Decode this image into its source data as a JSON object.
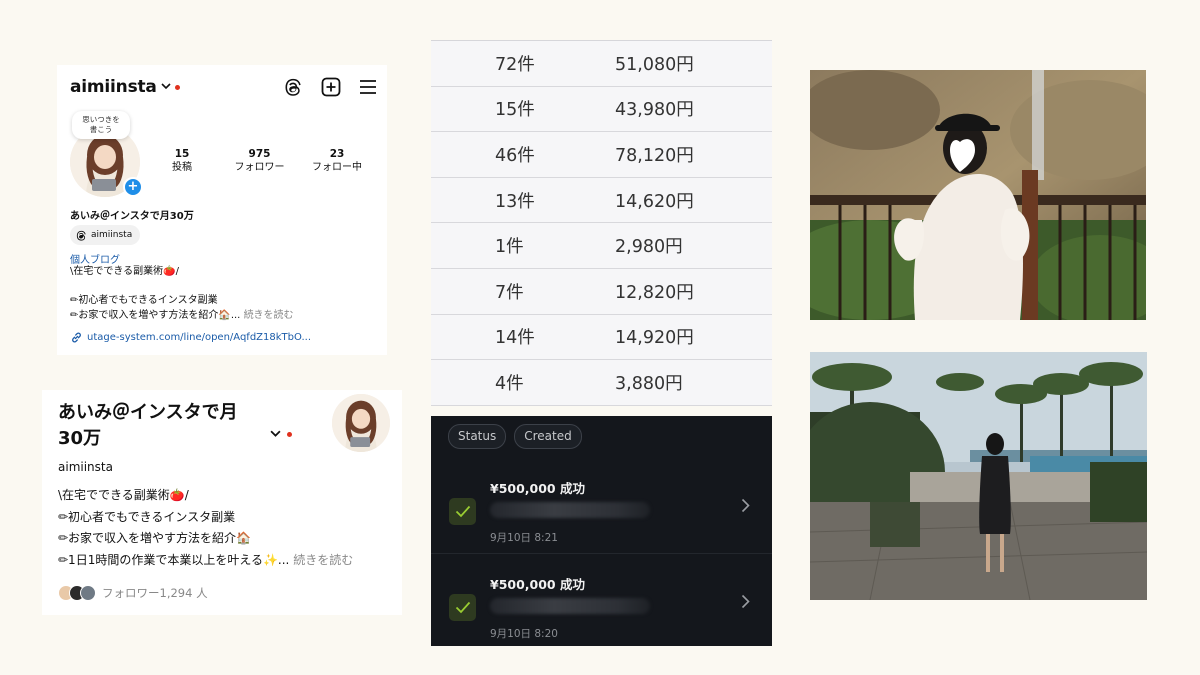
{
  "ig_profile": {
    "username": "aimiinsta",
    "note_bubble": "思いつきを\n書こう",
    "stats": [
      {
        "num": "15",
        "label": "投稿"
      },
      {
        "num": "975",
        "label": "フォロワー"
      },
      {
        "num": "23",
        "label": "フォロー中"
      }
    ],
    "display_name": "あいみ＠インスタで月30万",
    "threads_handle": "aimiinsta",
    "bio_link_title": "個人ブログ",
    "bio_lines": [
      "\\在宅でできる副業術🍅/",
      "",
      "✏初心者でもできるインスタ副業",
      "✏お家で収入を増やす方法を紹介🏠..."
    ],
    "more_label": "続きを読む",
    "link_url": "utage-system.com/line/open/AqfdZ18kTbO..."
  },
  "threads_profile": {
    "name": "あいみ＠インスタで月\n30万",
    "handle": "aimiinsta",
    "bio_lines": [
      "\\在宅でできる副業術🍅/",
      "✏初心者でもできるインスタ副業",
      "✏お家で収入を増やす方法を紹介🏠",
      "✏1日1時間の作業で本業以上を叶える✨..."
    ],
    "more_label": "続きを読む",
    "followers_text": "フォロワー1,294 人"
  },
  "sales_table": {
    "rows": [
      {
        "count": "72件",
        "amount": "51,080円"
      },
      {
        "count": "15件",
        "amount": "43,980円"
      },
      {
        "count": "46件",
        "amount": "78,120円"
      },
      {
        "count": "13件",
        "amount": "14,620円"
      },
      {
        "count": "1件",
        "amount": "2,980円"
      },
      {
        "count": "7件",
        "amount": "12,820円"
      },
      {
        "count": "14件",
        "amount": "14,920円"
      },
      {
        "count": "4件",
        "amount": "3,880円"
      }
    ]
  },
  "payments": {
    "filters": [
      "Status",
      "Created"
    ],
    "rows": [
      {
        "amount": "¥500,000 成功",
        "date": "9月10日 8:21"
      },
      {
        "amount": "¥500,000 成功",
        "date": "9月10日 8:20"
      }
    ]
  },
  "colors": {
    "page_bg": "#fbf9f2",
    "link_blue": "#1a5ba8",
    "badge_blue": "#1f8ee8",
    "red_dot": "#e0311e",
    "dark_panel": "#14171c",
    "check_green": "#9acd32"
  }
}
